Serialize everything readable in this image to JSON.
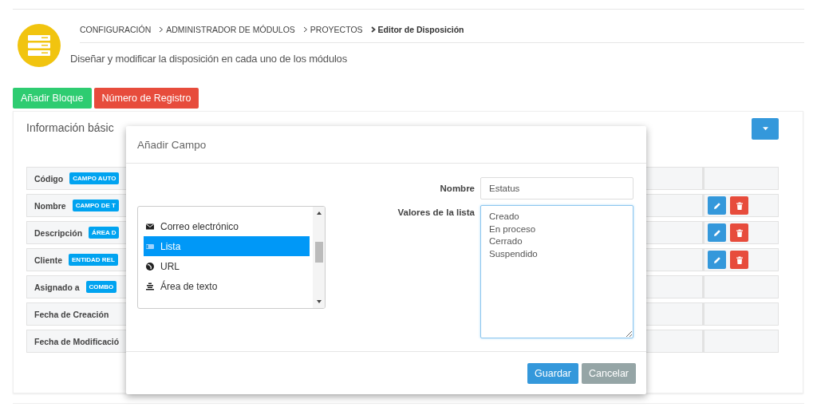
{
  "breadcrumb": [
    {
      "label": "CONFIGURACIÓN",
      "current": false
    },
    {
      "label": "ADMINISTRADOR DE MÓDULOS",
      "current": false
    },
    {
      "label": "PROYECTOS",
      "current": false
    },
    {
      "label": "Editor de Disposición",
      "current": true
    }
  ],
  "subtitle": "Diseñar y modificar la disposición en cada uno de los módulos",
  "toolbar": [
    {
      "label": "Añadir Bloque",
      "kind": "add"
    },
    {
      "label": "Número de Registro",
      "kind": "number"
    }
  ],
  "block": {
    "title": "Información básic",
    "rows": [
      {
        "label": "Código",
        "badge": "CAMPO AUTO",
        "actions": false
      },
      {
        "label": "Nombre",
        "badge": "CAMPO DE T",
        "actions": true
      },
      {
        "label": "Descripción",
        "badge": "ÁREA D",
        "actions": true
      },
      {
        "label": "Cliente",
        "badge": "ENTIDAD REL",
        "actions": true
      },
      {
        "label": "Asignado a",
        "badge": "COMBO",
        "actions": false
      },
      {
        "label": "Fecha de Creación",
        "actions": false
      },
      {
        "label": "Fecha de Modificació",
        "actions": false
      }
    ]
  },
  "dialog": {
    "title": "Añadir Campo",
    "field_types": [
      {
        "label": "Correo electrónico",
        "kind": "mail",
        "selected": false
      },
      {
        "label": "Lista",
        "kind": "list",
        "selected": true
      },
      {
        "label": "URL",
        "kind": "globe",
        "selected": false
      },
      {
        "label": "Área de texto",
        "kind": "textarea",
        "selected": false
      }
    ],
    "name_label": "Nombre",
    "name_value": "Estatus",
    "values_label": "Valores de la lista",
    "values": "Creado\nEn proceso\nCerrado\nSuspendido",
    "buttons": [
      {
        "label": "Guardar",
        "kind": "primary"
      },
      {
        "label": "Cancelar",
        "kind": "secondary"
      }
    ]
  }
}
